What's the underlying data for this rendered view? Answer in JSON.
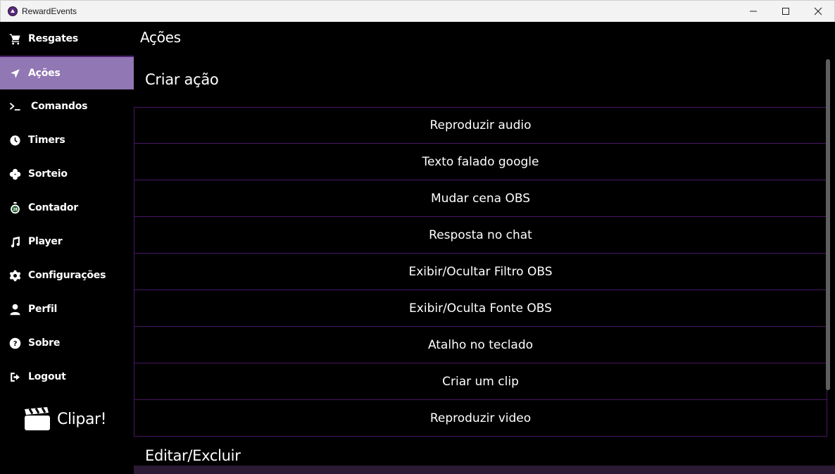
{
  "window": {
    "title": "RewardEvents"
  },
  "sidebar": {
    "items": [
      {
        "label": "Resgates",
        "icon": "cart-icon",
        "active": false
      },
      {
        "label": "Ações",
        "icon": "navigation-arrow-icon",
        "active": true
      },
      {
        "label": "Comandos",
        "icon": "terminal-icon",
        "active": false
      },
      {
        "label": "Timers",
        "icon": "clock-icon",
        "active": false
      },
      {
        "label": "Sorteio",
        "icon": "clover-icon",
        "active": false
      },
      {
        "label": "Contador",
        "icon": "stopwatch-icon",
        "active": false
      },
      {
        "label": "Player",
        "icon": "music-note-icon",
        "active": false
      },
      {
        "label": "Configurações",
        "icon": "gear-icon",
        "active": false
      },
      {
        "label": "Perfil",
        "icon": "user-icon",
        "active": false
      },
      {
        "label": "Sobre",
        "icon": "help-circle-icon",
        "active": false
      },
      {
        "label": "Logout",
        "icon": "logout-icon",
        "active": false
      }
    ],
    "clipar_label": "Clipar!"
  },
  "main": {
    "page_title": "Ações",
    "create_section_title": "Criar ação",
    "actions": [
      "Reproduzir audio",
      "Texto falado google",
      "Mudar cena OBS",
      "Resposta no chat",
      "Exibir/Ocultar Filtro OBS",
      "Exibir/Oculta Fonte OBS",
      "Atalho no teclado",
      "Criar um clip",
      "Reproduzir video"
    ],
    "edit_section_title": "Editar/Excluir"
  },
  "colors": {
    "active_nav_bg": "#9177b3",
    "action_border": "#4b1666",
    "background": "#000000"
  }
}
